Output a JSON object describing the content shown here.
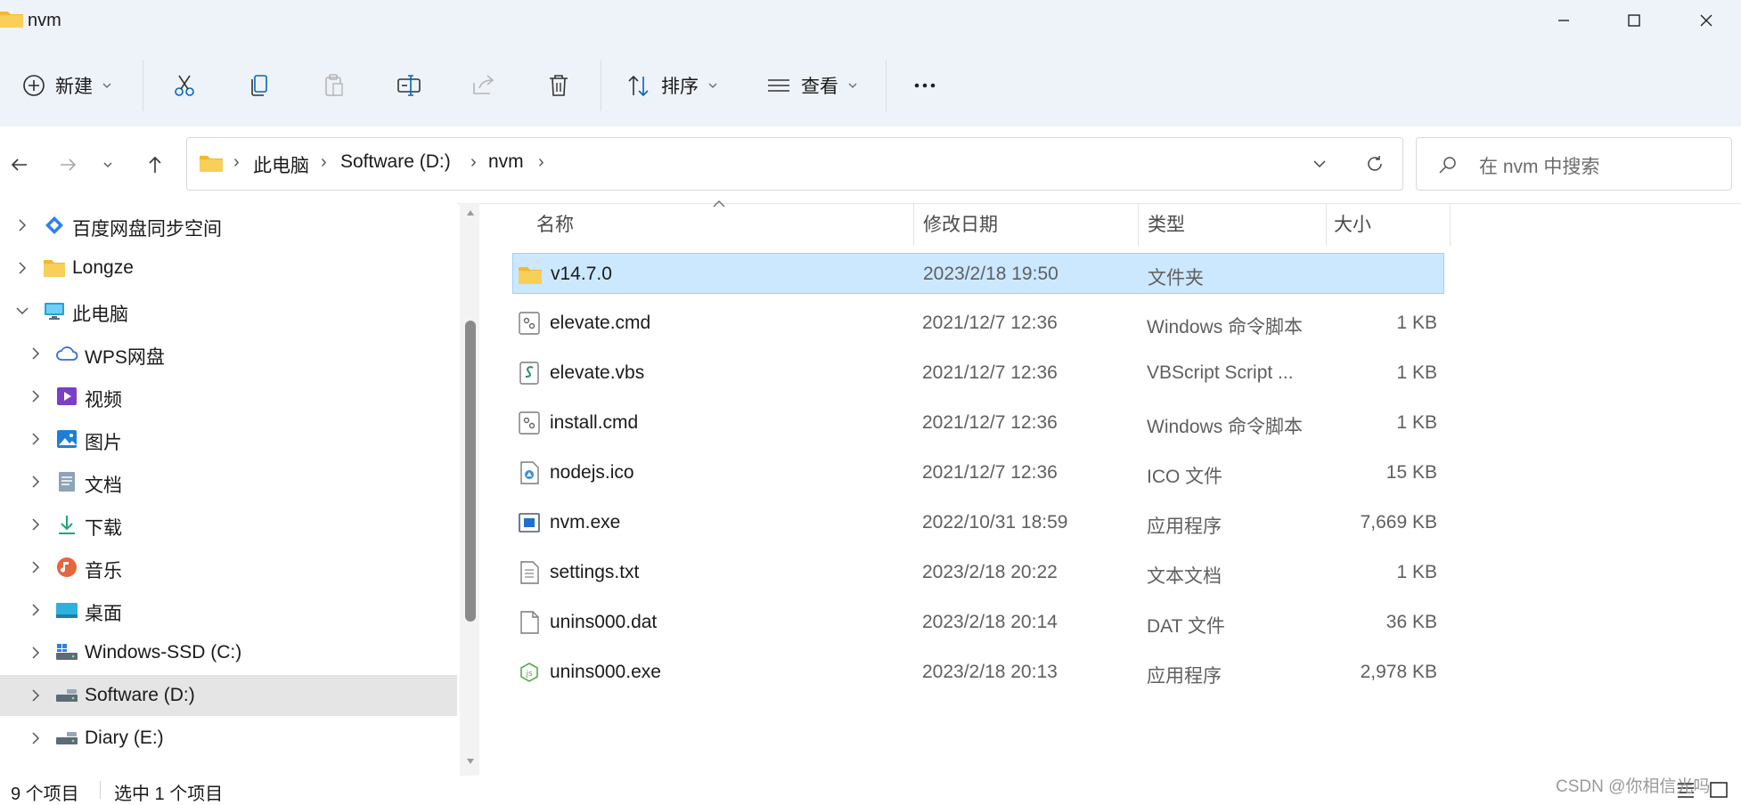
{
  "window": {
    "title": "nvm",
    "minimize_icon": "minimize-icon",
    "maximize_icon": "maximize-icon",
    "close_icon": "close-icon"
  },
  "ribbon": {
    "new_label": "新建",
    "sort_label": "排序",
    "view_label": "查看",
    "icons": [
      "add-circle-icon",
      "cut-icon",
      "copy-icon",
      "paste-icon",
      "rename-icon",
      "share-icon",
      "delete-icon",
      "sort-icon",
      "view-icon",
      "more-icon"
    ]
  },
  "nav": {
    "breadcrumbs": [
      "此电脑",
      "Software (D:)",
      "nvm"
    ],
    "search_placeholder": "在 nvm 中搜索"
  },
  "sidebar": {
    "items": [
      {
        "label": "百度网盘同步空间",
        "icon": "baidu-netdisk-icon"
      },
      {
        "label": "Longze",
        "icon": "folder-icon"
      },
      {
        "label": "此电脑",
        "icon": "computer-icon"
      },
      {
        "label": "WPS网盘",
        "icon": "cloud-icon"
      },
      {
        "label": "视频",
        "icon": "video-icon"
      },
      {
        "label": "图片",
        "icon": "pictures-icon"
      },
      {
        "label": "文档",
        "icon": "documents-icon"
      },
      {
        "label": "下载",
        "icon": "downloads-icon"
      },
      {
        "label": "音乐",
        "icon": "music-icon"
      },
      {
        "label": "桌面",
        "icon": "desktop-icon"
      },
      {
        "label": "Windows-SSD (C:)",
        "icon": "drive-icon"
      },
      {
        "label": "Software (D:)",
        "icon": "drive-icon"
      },
      {
        "label": "Diary (E:)",
        "icon": "drive-icon"
      }
    ],
    "selected": "Software (D:)"
  },
  "filelist": {
    "columns": {
      "name": "名称",
      "date": "修改日期",
      "type": "类型",
      "size": "大小"
    },
    "rows": [
      {
        "name": "v14.7.0",
        "date": "2023/2/18 19:50",
        "type": "文件夹",
        "size": "",
        "icon": "folder-icon"
      },
      {
        "name": "elevate.cmd",
        "date": "2021/12/7 12:36",
        "type": "Windows 命令脚本",
        "size": "1 KB",
        "icon": "cmd-script-icon"
      },
      {
        "name": "elevate.vbs",
        "date": "2021/12/7 12:36",
        "type": "VBScript Script ...",
        "size": "1 KB",
        "icon": "vbs-script-icon"
      },
      {
        "name": "install.cmd",
        "date": "2021/12/7 12:36",
        "type": "Windows 命令脚本",
        "size": "1 KB",
        "icon": "cmd-script-icon"
      },
      {
        "name": "nodejs.ico",
        "date": "2021/12/7 12:36",
        "type": "ICO 文件",
        "size": "15 KB",
        "icon": "ico-file-icon"
      },
      {
        "name": "nvm.exe",
        "date": "2022/10/31 18:59",
        "type": "应用程序",
        "size": "7,669 KB",
        "icon": "exe-icon"
      },
      {
        "name": "settings.txt",
        "date": "2023/2/18 20:22",
        "type": "文本文档",
        "size": "1 KB",
        "icon": "text-file-icon"
      },
      {
        "name": "unins000.dat",
        "date": "2023/2/18 20:14",
        "type": "DAT 文件",
        "size": "36 KB",
        "icon": "blank-file-icon"
      },
      {
        "name": "unins000.exe",
        "date": "2023/2/18 20:13",
        "type": "应用程序",
        "size": "2,978 KB",
        "icon": "installer-exe-icon"
      }
    ],
    "selected": "v14.7.0"
  },
  "status": {
    "item_count": "9 个项目",
    "selected_count": "选中 1 个项目",
    "watermark": "CSDN @你相信光吗"
  },
  "colors": {
    "selection_bg": "#cce8ff",
    "selection_border": "#99d1ff",
    "folder_yellow": "#f6c343",
    "accent_blue": "#0067c0"
  }
}
